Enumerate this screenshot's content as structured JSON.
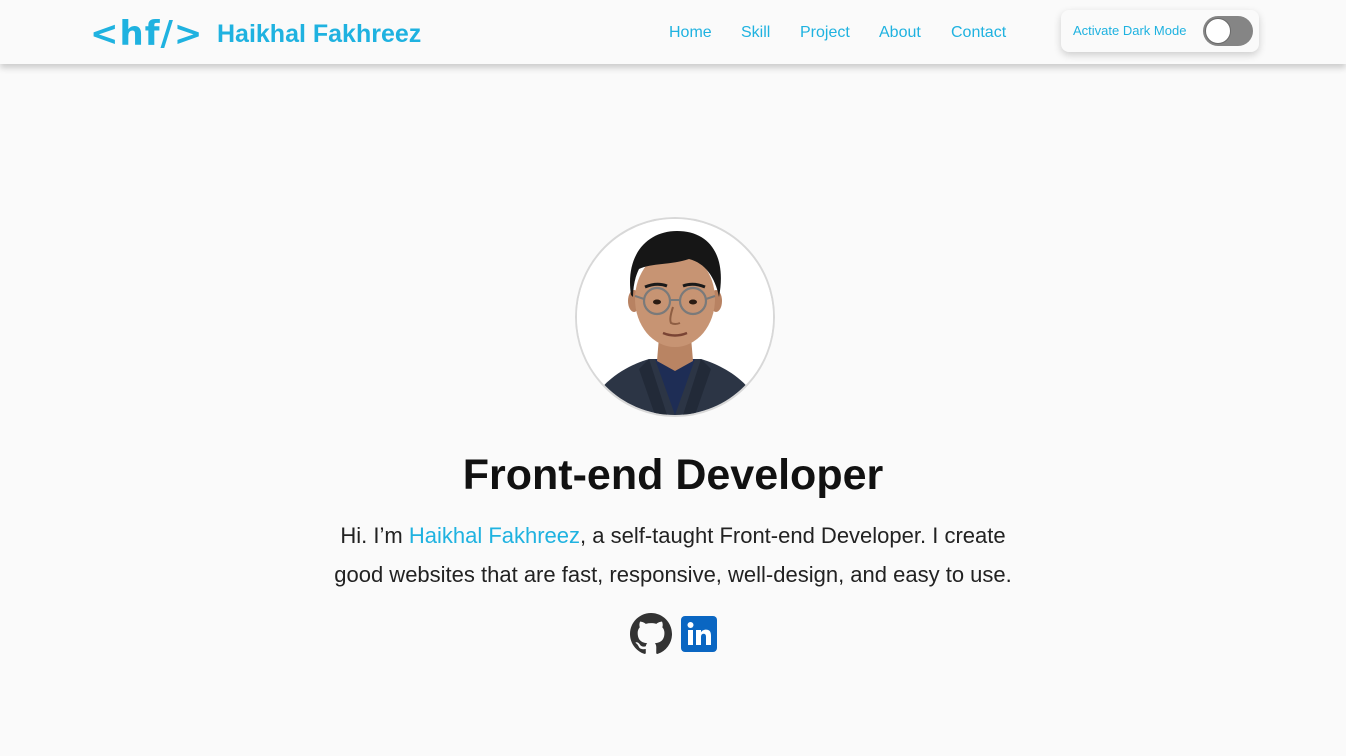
{
  "header": {
    "logo_mark": "<hf/>",
    "brand_name": "Haikhal Fakhreez",
    "nav": [
      {
        "label": "Home"
      },
      {
        "label": "Skill"
      },
      {
        "label": "Project"
      },
      {
        "label": "About"
      },
      {
        "label": "Contact"
      }
    ],
    "dark_mode": {
      "label": "Activate Dark Mode",
      "enabled": false
    }
  },
  "hero": {
    "title": "Front-end Developer",
    "bio_prefix": "Hi. I’m ",
    "bio_name": "Haikhal Fakhreez",
    "bio_line1_rest": ", a self-taught Front-end Developer. I create",
    "bio_line2": "good websites that are fast, responsive, well-design, and easy to use.",
    "socials": [
      {
        "icon": "github-icon"
      },
      {
        "icon": "linkedin-icon",
        "color": "#0a66c2"
      }
    ]
  },
  "colors": {
    "accent": "#1fb2e0",
    "background": "#fafafa",
    "text": "#111111",
    "toggle_off": "#858585",
    "linkedin": "#0a66c2"
  }
}
